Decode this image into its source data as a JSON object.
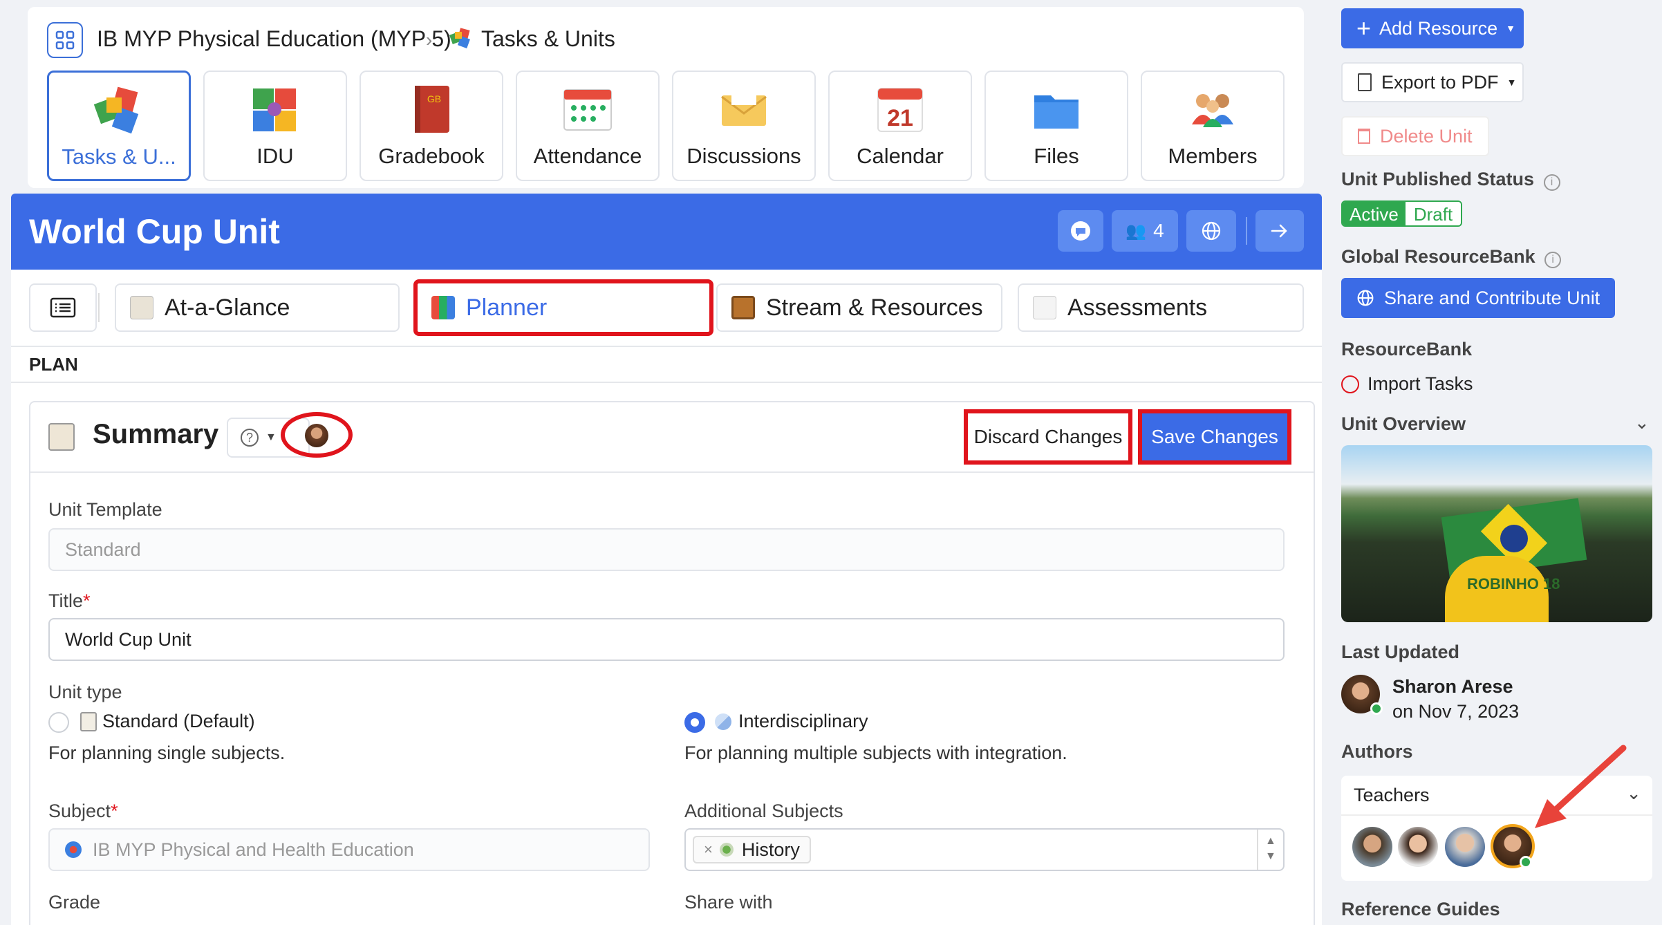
{
  "breadcrumb": {
    "course": "IB MYP Physical Education (MYP 5)",
    "page": "Tasks & Units"
  },
  "apps": [
    {
      "label": "Tasks & U...",
      "icon": "puzzle-icon"
    },
    {
      "label": "IDU",
      "icon": "puzzle-colorful-icon"
    },
    {
      "label": "Gradebook",
      "icon": "gradebook-icon"
    },
    {
      "label": "Attendance",
      "icon": "attendance-icon"
    },
    {
      "label": "Discussions",
      "icon": "envelope-icon"
    },
    {
      "label": "Calendar",
      "icon": "calendar-icon"
    },
    {
      "label": "Files",
      "icon": "folder-icon"
    },
    {
      "label": "Members",
      "icon": "members-icon"
    }
  ],
  "calendar_day": "21",
  "gradebook_letters": "GB",
  "unit": {
    "title": "World Cup Unit",
    "member_count": "4"
  },
  "tabs": [
    {
      "label": "At-a-Glance"
    },
    {
      "label": "Planner"
    },
    {
      "label": "Stream & Resources"
    },
    {
      "label": "Assessments"
    }
  ],
  "section_label": "PLAN",
  "summary": {
    "heading": "Summary",
    "discard_label": "Discard Changes",
    "save_label": "Save Changes",
    "unit_template_label": "Unit Template",
    "unit_template_placeholder": "Standard",
    "title_label": "Title",
    "title_value": "World Cup Unit",
    "unit_type_label": "Unit type",
    "type_standard": "Standard (Default)",
    "type_standard_desc": "For planning single subjects.",
    "type_inter": "Interdisciplinary",
    "type_inter_desc": "For planning multiple subjects with integration.",
    "subject_label": "Subject",
    "subject_value": "IB MYP Physical and Health Education",
    "additional_label": "Additional Subjects",
    "additional_tag": "History",
    "grade_label": "Grade",
    "share_label": "Share with",
    "required_mark": "*"
  },
  "sidebar": {
    "add_resource": "Add Resource",
    "export_pdf": "Export to PDF",
    "delete_unit": "Delete Unit",
    "published_status_label": "Unit Published Status",
    "status_active": "Active",
    "status_draft": "Draft",
    "global_rb_label": "Global ResourceBank",
    "share_contribute": "Share and Contribute Unit",
    "rb_label": "ResourceBank",
    "import_tasks": "Import Tasks",
    "unit_overview": "Unit Overview",
    "image_text": "ROBINHO 18",
    "last_updated_label": "Last Updated",
    "updater_name": "Sharon Arese",
    "updated_on": "on Nov 7, 2023",
    "authors_label": "Authors",
    "teachers_select": "Teachers",
    "reference_guides": "Reference Guides"
  },
  "colors": {
    "accent": "#3b6be6",
    "danger": "#e0141c",
    "active_green": "#2fa84f"
  }
}
